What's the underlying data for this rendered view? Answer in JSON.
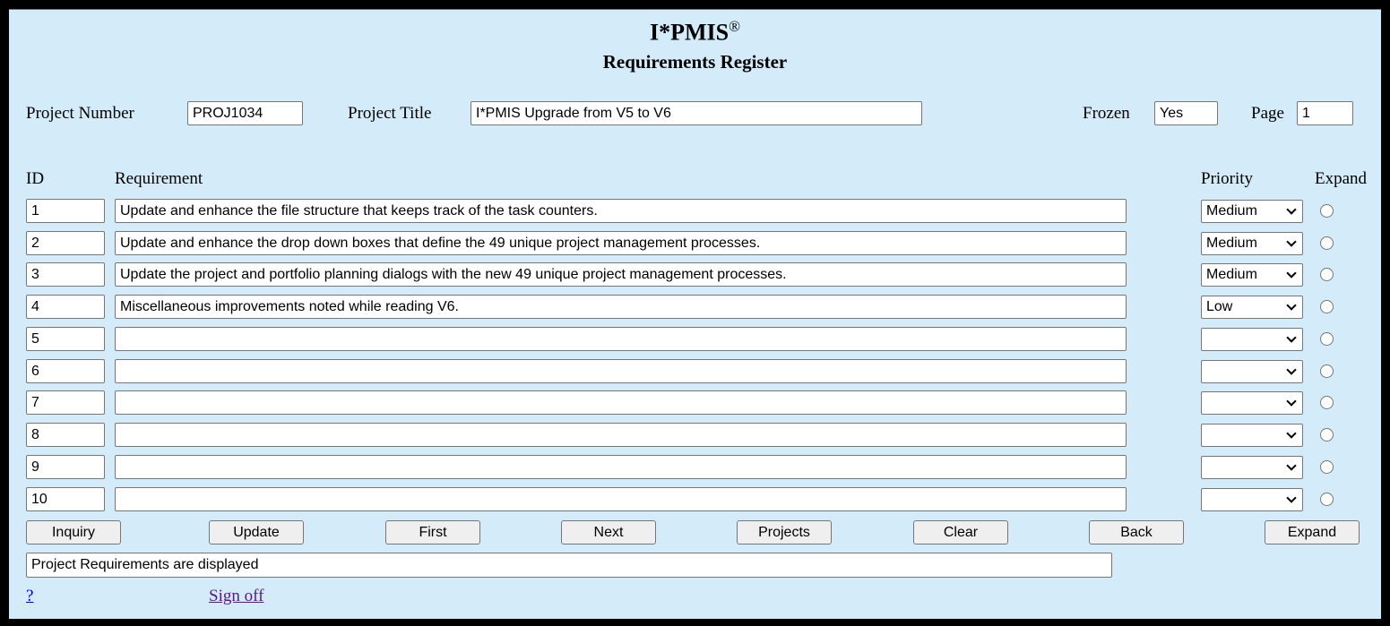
{
  "header": {
    "app_title": "I*PMIS",
    "registered_mark": "®",
    "page_title": "Requirements Register"
  },
  "fields": {
    "project_number": {
      "label": "Project Number",
      "value": "PROJ1034"
    },
    "project_title": {
      "label": "Project Title",
      "value": "I*PMIS Upgrade from V5 to V6"
    },
    "frozen": {
      "label": "Frozen",
      "value": "Yes"
    },
    "page": {
      "label": "Page",
      "value": "1"
    }
  },
  "columns": {
    "id": "ID",
    "requirement": "Requirement",
    "priority": "Priority",
    "expand": "Expand"
  },
  "rows": [
    {
      "id": "1",
      "requirement": "Update and enhance the file structure that keeps track of the task counters.",
      "priority": "Medium"
    },
    {
      "id": "2",
      "requirement": "Update and enhance the drop down boxes that define the 49 unique project management processes.",
      "priority": "Medium"
    },
    {
      "id": "3",
      "requirement": "Update the project and portfolio planning dialogs with the new 49 unique project management processes.",
      "priority": "Medium"
    },
    {
      "id": "4",
      "requirement": "Miscellaneous improvements noted while reading V6.",
      "priority": "Low"
    },
    {
      "id": "5",
      "requirement": "",
      "priority": ""
    },
    {
      "id": "6",
      "requirement": "",
      "priority": ""
    },
    {
      "id": "7",
      "requirement": "",
      "priority": ""
    },
    {
      "id": "8",
      "requirement": "",
      "priority": ""
    },
    {
      "id": "9",
      "requirement": "",
      "priority": ""
    },
    {
      "id": "10",
      "requirement": "",
      "priority": ""
    }
  ],
  "buttons": [
    "Inquiry",
    "Update",
    "First",
    "Next",
    "Projects",
    "Clear",
    "Back",
    "Expand"
  ],
  "status_message": "Project Requirements are displayed",
  "links": {
    "help": "?",
    "sign_off": "Sign off"
  },
  "colors": {
    "background": "#d4ebf9",
    "help_link": "#0000ee",
    "visited_link": "#551a8b"
  }
}
